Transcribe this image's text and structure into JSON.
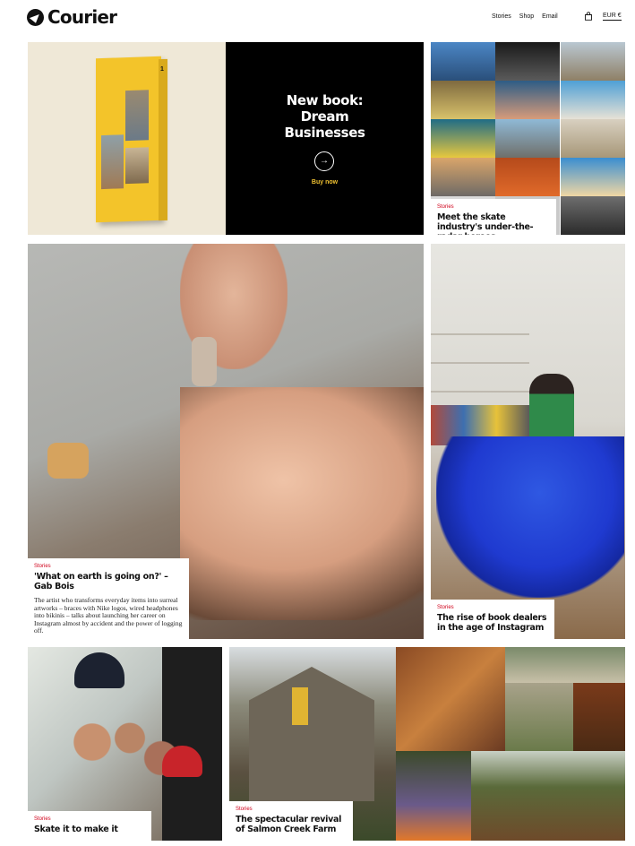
{
  "brand": {
    "name": "Courier"
  },
  "nav": {
    "items": [
      "Stories",
      "Shop",
      "Email"
    ],
    "currency": "EUR €"
  },
  "promo": {
    "title_lines": [
      "New book:",
      "Dream",
      "Businesses"
    ],
    "arrow": "→",
    "link": "Buy now",
    "book_number": "1"
  },
  "tiles": {
    "skate_industry": {
      "tag": "Stories",
      "title": "Meet the skate industry's under-the-radar heroes"
    },
    "gab_bois": {
      "tag": "Stories",
      "title": "'What on earth is going on?' – Gab Bois",
      "body": "The artist who transforms everyday items into surreal artworks – braces with Nike logos, wired headphones into bikinis – talks about launching her career on Instagram almost by accident and the power of logging off."
    },
    "book_dealers": {
      "tag": "Stories",
      "title": "The rise of book dealers in the age of Instagram"
    },
    "skate_make_it": {
      "tag": "Stories",
      "title": "Skate it to make it"
    },
    "salmon_creek": {
      "tag": "Stories",
      "title": "The spectacular revival of Salmon Creek Farm"
    }
  },
  "icons": {
    "logo": "courier-logo-icon",
    "cart": "bag-icon",
    "arrow": "arrow-right-icon"
  },
  "colors": {
    "accent_red": "#d0021b",
    "promo_bg": "#000000",
    "link_yellow": "#f1c232",
    "book_yellow": "#f3c42a"
  }
}
